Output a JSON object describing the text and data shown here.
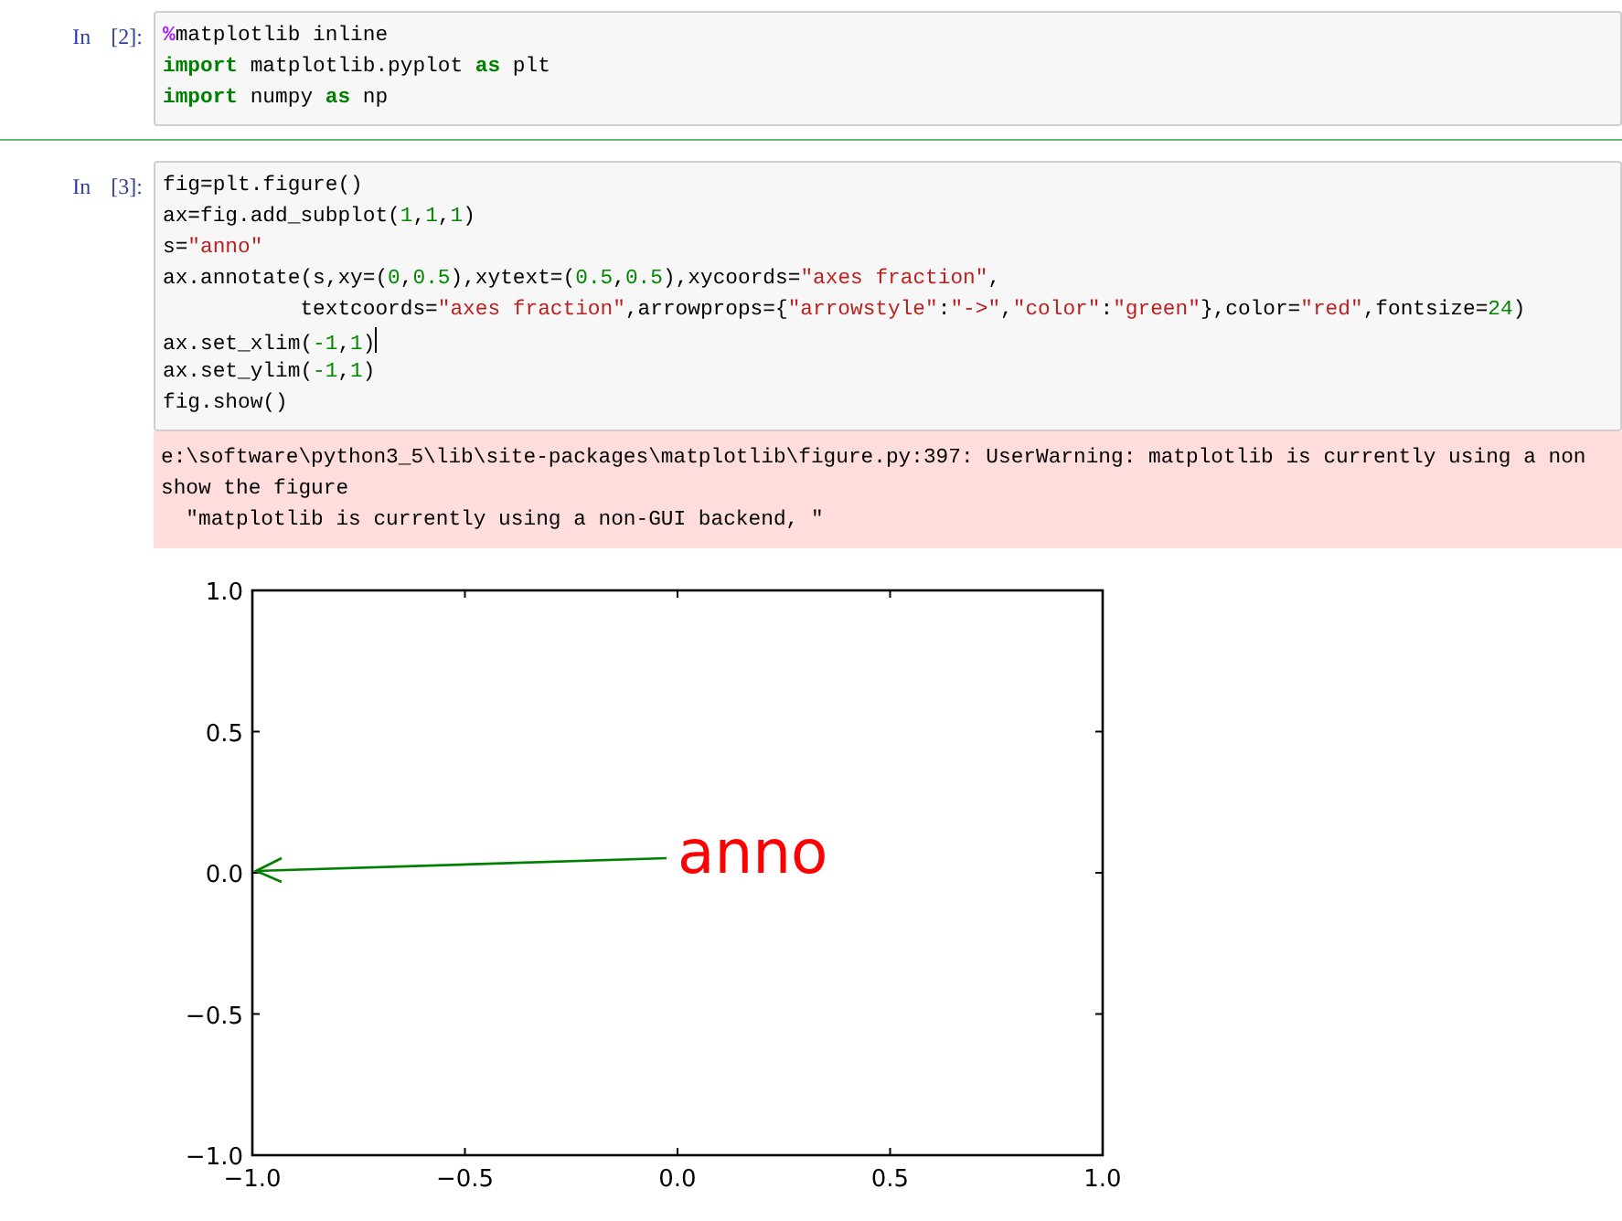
{
  "cells": [
    {
      "prompt": "In [2]:",
      "selected": false,
      "code": [
        {
          "cursor": false,
          "tokens": [
            {
              "text": "%",
              "kind": "magic"
            },
            {
              "text": "matplotlib inline",
              "kind": "plain"
            }
          ]
        },
        {
          "cursor": false,
          "tokens": [
            {
              "text": "import",
              "kind": "keyword"
            },
            {
              "text": " matplotlib.pyplot ",
              "kind": "plain"
            },
            {
              "text": "as",
              "kind": "keyword"
            },
            {
              "text": " plt",
              "kind": "plain"
            }
          ]
        },
        {
          "cursor": false,
          "tokens": [
            {
              "text": "import",
              "kind": "keyword"
            },
            {
              "text": " numpy ",
              "kind": "plain"
            },
            {
              "text": "as",
              "kind": "keyword"
            },
            {
              "text": " np",
              "kind": "plain"
            }
          ]
        }
      ]
    },
    {
      "prompt": "In [3]:",
      "selected": true,
      "code": [
        {
          "cursor": false,
          "tokens": [
            {
              "text": "fig=plt.figure()",
              "kind": "plain"
            }
          ]
        },
        {
          "cursor": false,
          "tokens": [
            {
              "text": "ax=fig.add_subplot(",
              "kind": "plain"
            },
            {
              "text": "1",
              "kind": "number"
            },
            {
              "text": ",",
              "kind": "plain"
            },
            {
              "text": "1",
              "kind": "number"
            },
            {
              "text": ",",
              "kind": "plain"
            },
            {
              "text": "1",
              "kind": "number"
            },
            {
              "text": ")",
              "kind": "plain"
            }
          ]
        },
        {
          "cursor": false,
          "tokens": [
            {
              "text": "s=",
              "kind": "plain"
            },
            {
              "text": "\"anno\"",
              "kind": "string"
            }
          ]
        },
        {
          "cursor": false,
          "tokens": [
            {
              "text": "ax.annotate(s,xy=(",
              "kind": "plain"
            },
            {
              "text": "0",
              "kind": "number"
            },
            {
              "text": ",",
              "kind": "plain"
            },
            {
              "text": "0.5",
              "kind": "number"
            },
            {
              "text": "),xytext=(",
              "kind": "plain"
            },
            {
              "text": "0.5",
              "kind": "number"
            },
            {
              "text": ",",
              "kind": "plain"
            },
            {
              "text": "0.5",
              "kind": "number"
            },
            {
              "text": "),xycoords=",
              "kind": "plain"
            },
            {
              "text": "\"axes fraction\"",
              "kind": "string"
            },
            {
              "text": ",",
              "kind": "plain"
            }
          ]
        },
        {
          "cursor": false,
          "tokens": [
            {
              "text": "           textcoords=",
              "kind": "plain"
            },
            {
              "text": "\"axes fraction\"",
              "kind": "string"
            },
            {
              "text": ",arrowprops={",
              "kind": "plain"
            },
            {
              "text": "\"arrowstyle\"",
              "kind": "string"
            },
            {
              "text": ":",
              "kind": "plain"
            },
            {
              "text": "\"->\"",
              "kind": "string"
            },
            {
              "text": ",",
              "kind": "plain"
            },
            {
              "text": "\"color\"",
              "kind": "string"
            },
            {
              "text": ":",
              "kind": "plain"
            },
            {
              "text": "\"green\"",
              "kind": "string"
            },
            {
              "text": "},color=",
              "kind": "plain"
            },
            {
              "text": "\"red\"",
              "kind": "string"
            },
            {
              "text": ",fontsize=",
              "kind": "plain"
            },
            {
              "text": "24",
              "kind": "number"
            },
            {
              "text": ")",
              "kind": "plain"
            }
          ]
        },
        {
          "cursor": true,
          "tokens": [
            {
              "text": "ax.set_xlim(",
              "kind": "plain"
            },
            {
              "text": "-1",
              "kind": "number"
            },
            {
              "text": ",",
              "kind": "plain"
            },
            {
              "text": "1",
              "kind": "number"
            },
            {
              "text": ")",
              "kind": "plain"
            }
          ]
        },
        {
          "cursor": false,
          "tokens": [
            {
              "text": "ax.set_ylim(",
              "kind": "plain"
            },
            {
              "text": "-1",
              "kind": "number"
            },
            {
              "text": ",",
              "kind": "plain"
            },
            {
              "text": "1",
              "kind": "number"
            },
            {
              "text": ")",
              "kind": "plain"
            }
          ]
        },
        {
          "cursor": false,
          "tokens": [
            {
              "text": "fig.show()",
              "kind": "plain"
            }
          ]
        }
      ],
      "stderr": "e:\\software\\python3_5\\lib\\site-packages\\matplotlib\\figure.py:397: UserWarning: matplotlib is currently using a non\nshow the figure\n  \"matplotlib is currently using a non-GUI backend, \"",
      "chart_data": {
        "type": "line",
        "xlim": [
          -1,
          1
        ],
        "ylim": [
          -1,
          1
        ],
        "xticks": [
          {
            "value": -1,
            "label": "−1.0"
          },
          {
            "value": -0.5,
            "label": "−0.5"
          },
          {
            "value": 0,
            "label": "0.0"
          },
          {
            "value": 0.5,
            "label": "0.5"
          },
          {
            "value": 1,
            "label": "1.0"
          }
        ],
        "yticks": [
          {
            "value": -1,
            "label": "−1.0"
          },
          {
            "value": -0.5,
            "label": "−0.5"
          },
          {
            "value": 0,
            "label": "0.0"
          },
          {
            "value": 0.5,
            "label": "0.5"
          },
          {
            "value": 1,
            "label": "1.0"
          }
        ],
        "annotations": [
          "anno"
        ]
      }
    }
  ]
}
